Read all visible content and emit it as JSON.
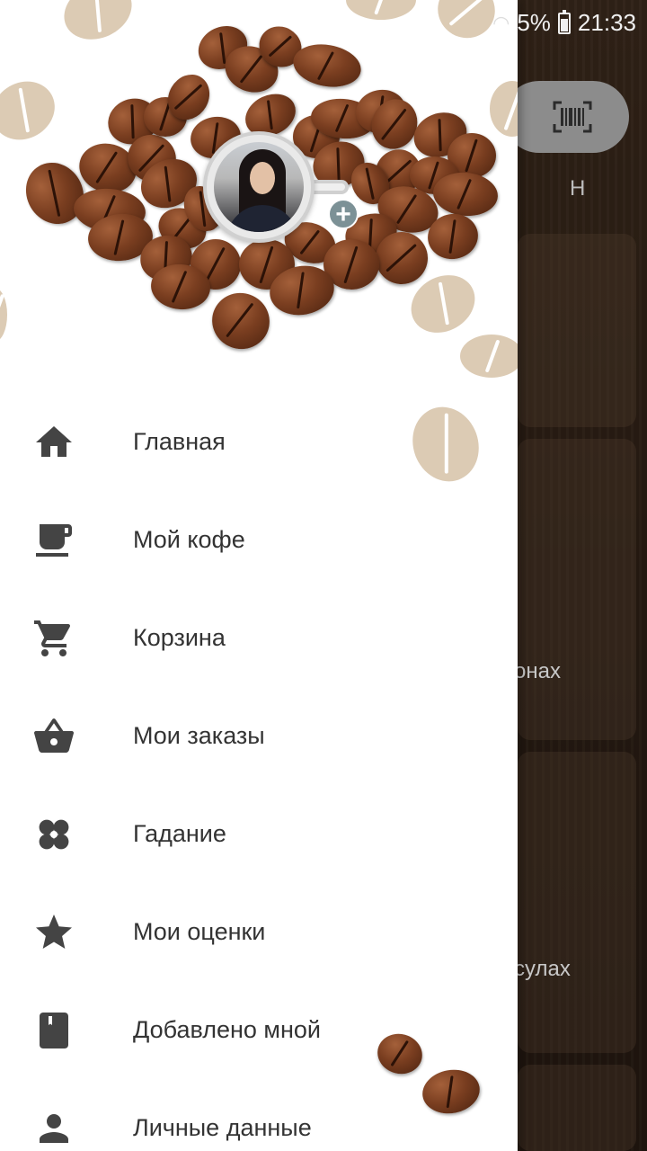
{
  "status_bar": {
    "battery": "5%",
    "time": "21:33"
  },
  "background": {
    "header_letter": "Н",
    "label_1": "онах",
    "label_2": "сулах"
  },
  "drawer": {
    "menu": [
      {
        "label": "Главная",
        "icon": "home-icon"
      },
      {
        "label": "Мой кофе",
        "icon": "coffee-cup-icon"
      },
      {
        "label": "Корзина",
        "icon": "cart-icon"
      },
      {
        "label": "Мои заказы",
        "icon": "basket-icon"
      },
      {
        "label": "Гадание",
        "icon": "clover-icon"
      },
      {
        "label": "Мои оценки",
        "icon": "star-icon"
      },
      {
        "label": "Добавлено мной",
        "icon": "bookmark-icon"
      },
      {
        "label": "Личные данные",
        "icon": "person-icon"
      }
    ]
  },
  "colors": {
    "icon": "#444444",
    "label": "#333333",
    "drawer_bg": "#ffffff",
    "bean_deco": "#dccbb4"
  }
}
